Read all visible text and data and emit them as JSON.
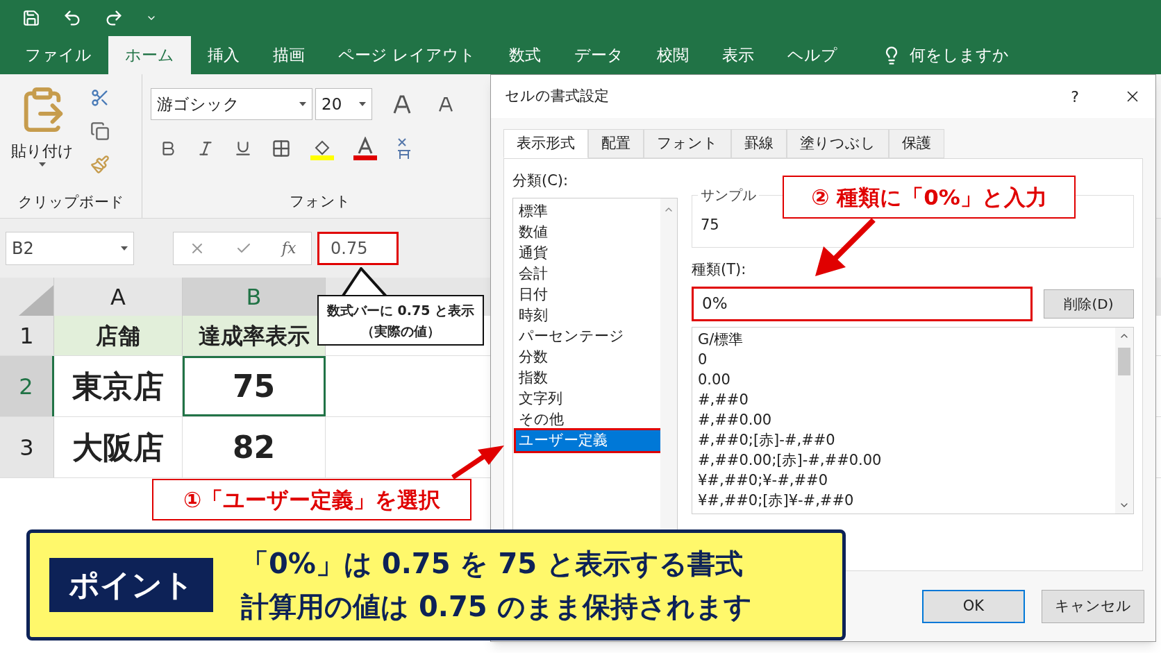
{
  "ribbon_tabs": [
    {
      "label": "ファイル",
      "selected": false
    },
    {
      "label": "ホーム",
      "selected": true
    },
    {
      "label": "挿入",
      "selected": false
    },
    {
      "label": "描画",
      "selected": false
    },
    {
      "label": "ページ レイアウト",
      "selected": false
    },
    {
      "label": "数式",
      "selected": false
    },
    {
      "label": "データ",
      "selected": false
    },
    {
      "label": "校閲",
      "selected": false
    },
    {
      "label": "表示",
      "selected": false
    },
    {
      "label": "ヘルプ",
      "selected": false
    }
  ],
  "tell_me": "何をしますか",
  "clipboard": {
    "paste_label": "貼り付け",
    "group_label": "クリップボード"
  },
  "font_group": {
    "font_name": "游ゴシック",
    "font_size": "20",
    "group_label": "フォント"
  },
  "formula_bar": {
    "name_box": "B2",
    "function_label": "fx",
    "value": "0.75"
  },
  "sheet": {
    "columns": [
      {
        "label": "A",
        "selected": false
      },
      {
        "label": "B",
        "selected": true
      }
    ],
    "rows": [
      {
        "header": "1",
        "kind": "header",
        "selected": false,
        "cells": [
          "店舗",
          "達成率表示"
        ]
      },
      {
        "header": "2",
        "kind": "data",
        "selected": true,
        "cells": [
          "東京店",
          "75"
        ]
      },
      {
        "header": "3",
        "kind": "data",
        "selected": false,
        "cells": [
          "大阪店",
          "82"
        ]
      }
    ]
  },
  "formula_callout": {
    "lines": [
      "数式バーに 0.75 と表示",
      "（実際の値）"
    ]
  },
  "dialog": {
    "title": "セルの書式設定",
    "help": "?",
    "tabs": [
      {
        "label": "表示形式",
        "selected": true
      },
      {
        "label": "配置",
        "selected": false
      },
      {
        "label": "フォント",
        "selected": false
      },
      {
        "label": "罫線",
        "selected": false
      },
      {
        "label": "塗りつぶし",
        "selected": false
      },
      {
        "label": "保護",
        "selected": false
      }
    ],
    "category_label": "分類(C):",
    "categories": [
      {
        "label": "標準",
        "selected": false
      },
      {
        "label": "数値",
        "selected": false
      },
      {
        "label": "通貨",
        "selected": false
      },
      {
        "label": "会計",
        "selected": false
      },
      {
        "label": "日付",
        "selected": false
      },
      {
        "label": "時刻",
        "selected": false
      },
      {
        "label": "パーセンテージ",
        "selected": false
      },
      {
        "label": "分数",
        "selected": false
      },
      {
        "label": "指数",
        "selected": false
      },
      {
        "label": "文字列",
        "selected": false
      },
      {
        "label": "その他",
        "selected": false
      },
      {
        "label": "ユーザー定義",
        "selected": true
      }
    ],
    "sample_label": "サンプル",
    "sample_value": "75",
    "type_label": "種類(T):",
    "type_value": "0%",
    "delete_button": "削除(D)",
    "formats": [
      "G/標準",
      "0",
      "0.00",
      "#,##0",
      "#,##0.00",
      "#,##0;[赤]-#,##0",
      "#,##0.00;[赤]-#,##0.00",
      "¥#,##0;¥-#,##0",
      "¥#,##0;[赤]¥-#,##0"
    ],
    "buttons": [
      "OK",
      "キャンセル"
    ]
  },
  "annotations": [
    "①「ユーザー定義」を選択",
    "② 種類に「0%」と入力"
  ],
  "point": {
    "badge": "ポイント",
    "lines": [
      "「0%」は 0.75 を 75 と表示する書式",
      "計算用の値は 0.75 のまま保持されます"
    ]
  }
}
